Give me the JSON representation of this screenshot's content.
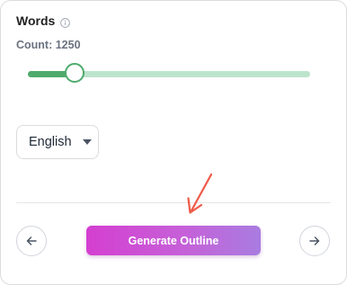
{
  "words": {
    "title": "Words",
    "info_icon": "info-circle-icon",
    "count_label": "Count: 1250"
  },
  "slider": {
    "value": 1250,
    "fraction": 0.165,
    "fill_color": "#4faa6d",
    "track_color": "#bce4cd"
  },
  "language": {
    "selected": "English",
    "icon": "caret-down-icon"
  },
  "footer": {
    "prev_icon": "arrow-left-icon",
    "generate_label": "Generate Outline",
    "next_icon": "arrow-right-icon",
    "pointer_icon": "red-arrow-pointer-icon",
    "generate_gradient": [
      "#d43fd0",
      "#a97ce0"
    ]
  }
}
